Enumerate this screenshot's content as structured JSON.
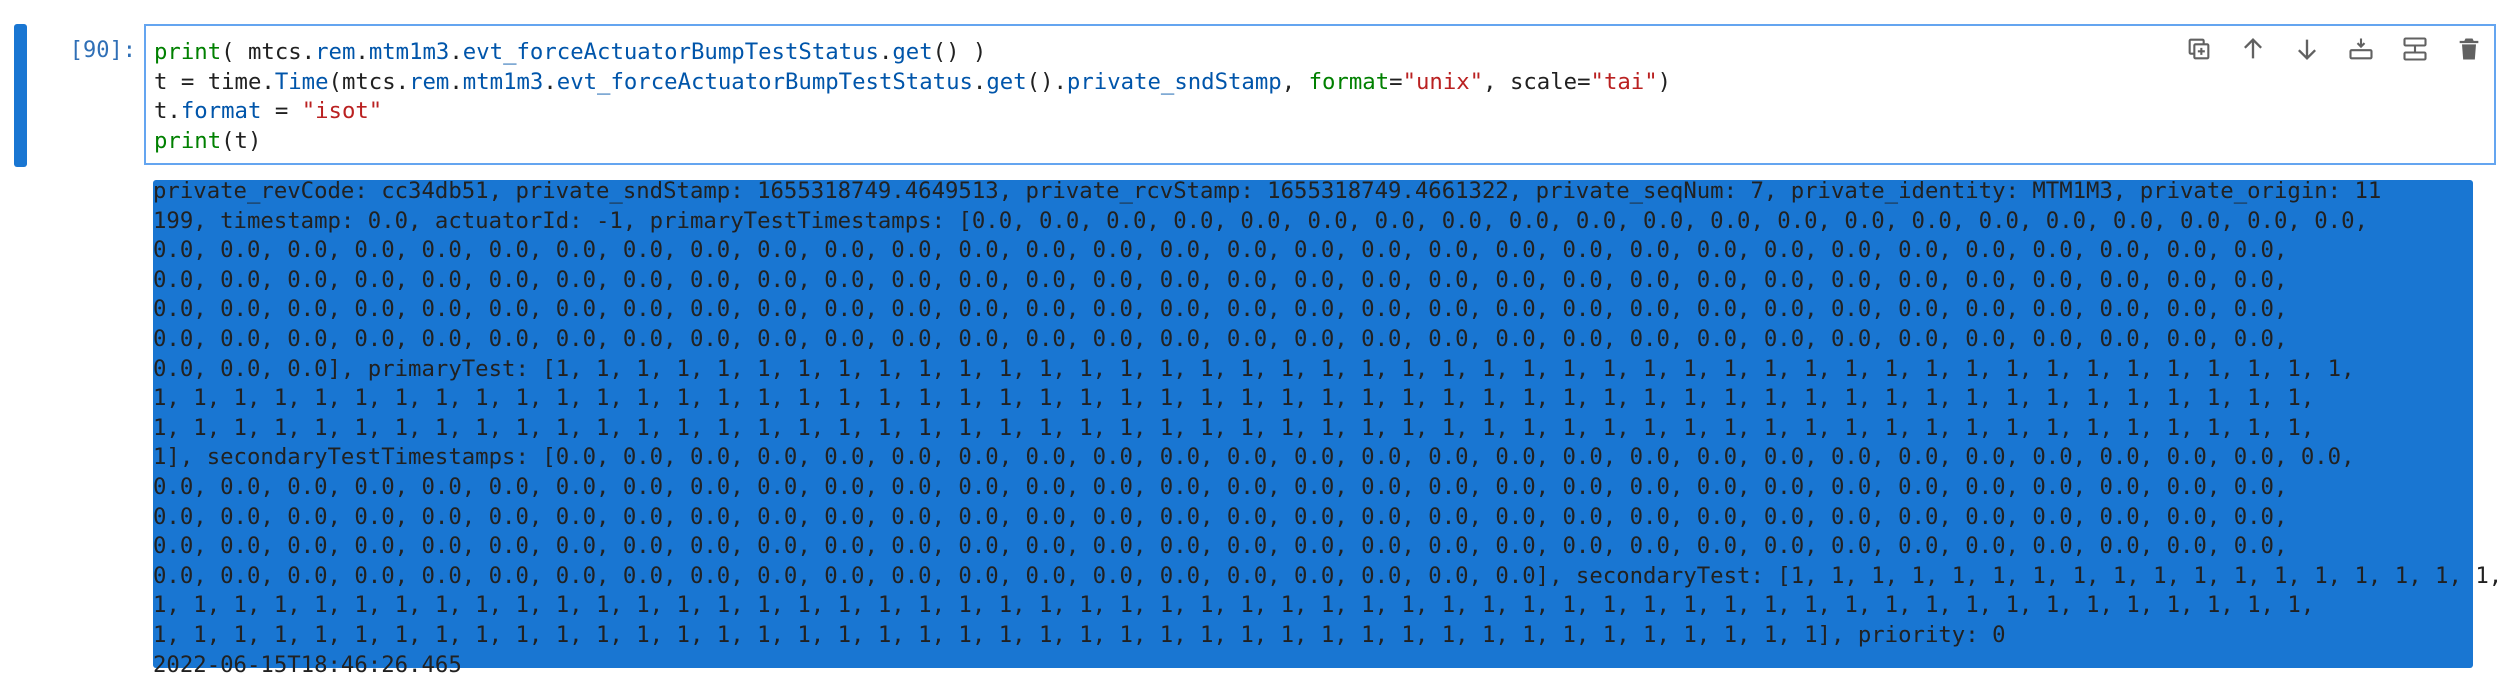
{
  "cell": {
    "prompt": "[90]:",
    "code_lines": [
      [
        {
          "t": "print",
          "c": "kw-builtin"
        },
        {
          "t": "( mtcs.",
          "c": ""
        },
        {
          "t": "rem",
          "c": "obj"
        },
        {
          "t": ".",
          "c": ""
        },
        {
          "t": "mtm1m3",
          "c": "obj"
        },
        {
          "t": ".",
          "c": ""
        },
        {
          "t": "evt_forceActuatorBumpTestStatus",
          "c": "obj"
        },
        {
          "t": ".",
          "c": ""
        },
        {
          "t": "get",
          "c": "obj"
        },
        {
          "t": "() )",
          "c": ""
        }
      ],
      [
        {
          "t": "t = time.",
          "c": ""
        },
        {
          "t": "Time",
          "c": "obj"
        },
        {
          "t": "(mtcs.",
          "c": ""
        },
        {
          "t": "rem",
          "c": "obj"
        },
        {
          "t": ".",
          "c": ""
        },
        {
          "t": "mtm1m3",
          "c": "obj"
        },
        {
          "t": ".",
          "c": ""
        },
        {
          "t": "evt_forceActuatorBumpTestStatus",
          "c": "obj"
        },
        {
          "t": ".",
          "c": ""
        },
        {
          "t": "get",
          "c": "obj"
        },
        {
          "t": "().",
          "c": ""
        },
        {
          "t": "private_sndStamp",
          "c": "obj"
        },
        {
          "t": ", ",
          "c": ""
        },
        {
          "t": "format",
          "c": "arg"
        },
        {
          "t": "=",
          "c": ""
        },
        {
          "t": "\"unix\"",
          "c": "str"
        },
        {
          "t": ", scale=",
          "c": ""
        },
        {
          "t": "\"tai\"",
          "c": "str"
        },
        {
          "t": ")",
          "c": ""
        }
      ],
      [
        {
          "t": "t.",
          "c": ""
        },
        {
          "t": "format",
          "c": "obj"
        },
        {
          "t": " = ",
          "c": ""
        },
        {
          "t": "\"isot\"",
          "c": "str"
        }
      ],
      [
        {
          "t": "print",
          "c": "kw-builtin"
        },
        {
          "t": "(t)",
          "c": ""
        }
      ]
    ],
    "output_lines": [
      "private_revCode: cc34db51, private_sndStamp: 1655318749.4649513, private_rcvStamp: 1655318749.4661322, private_seqNum: 7, private_identity: MTM1M3, private_origin: 11",
      "199, timestamp: 0.0, actuatorId: -1, primaryTestTimestamps: [0.0, 0.0, 0.0, 0.0, 0.0, 0.0, 0.0, 0.0, 0.0, 0.0, 0.0, 0.0, 0.0, 0.0, 0.0, 0.0, 0.0, 0.0, 0.0, 0.0, 0.0,",
      "0.0, 0.0, 0.0, 0.0, 0.0, 0.0, 0.0, 0.0, 0.0, 0.0, 0.0, 0.0, 0.0, 0.0, 0.0, 0.0, 0.0, 0.0, 0.0, 0.0, 0.0, 0.0, 0.0, 0.0, 0.0, 0.0, 0.0, 0.0, 0.0, 0.0, 0.0, 0.0,",
      "0.0, 0.0, 0.0, 0.0, 0.0, 0.0, 0.0, 0.0, 0.0, 0.0, 0.0, 0.0, 0.0, 0.0, 0.0, 0.0, 0.0, 0.0, 0.0, 0.0, 0.0, 0.0, 0.0, 0.0, 0.0, 0.0, 0.0, 0.0, 0.0, 0.0, 0.0, 0.0,",
      "0.0, 0.0, 0.0, 0.0, 0.0, 0.0, 0.0, 0.0, 0.0, 0.0, 0.0, 0.0, 0.0, 0.0, 0.0, 0.0, 0.0, 0.0, 0.0, 0.0, 0.0, 0.0, 0.0, 0.0, 0.0, 0.0, 0.0, 0.0, 0.0, 0.0, 0.0, 0.0,",
      "0.0, 0.0, 0.0, 0.0, 0.0, 0.0, 0.0, 0.0, 0.0, 0.0, 0.0, 0.0, 0.0, 0.0, 0.0, 0.0, 0.0, 0.0, 0.0, 0.0, 0.0, 0.0, 0.0, 0.0, 0.0, 0.0, 0.0, 0.0, 0.0, 0.0, 0.0, 0.0,",
      "0.0, 0.0, 0.0], primaryTest: [1, 1, 1, 1, 1, 1, 1, 1, 1, 1, 1, 1, 1, 1, 1, 1, 1, 1, 1, 1, 1, 1, 1, 1, 1, 1, 1, 1, 1, 1, 1, 1, 1, 1, 1, 1, 1, 1, 1, 1, 1, 1, 1, 1, 1,",
      "1, 1, 1, 1, 1, 1, 1, 1, 1, 1, 1, 1, 1, 1, 1, 1, 1, 1, 1, 1, 1, 1, 1, 1, 1, 1, 1, 1, 1, 1, 1, 1, 1, 1, 1, 1, 1, 1, 1, 1, 1, 1, 1, 1, 1, 1, 1, 1, 1, 1, 1, 1, 1, 1,",
      "1, 1, 1, 1, 1, 1, 1, 1, 1, 1, 1, 1, 1, 1, 1, 1, 1, 1, 1, 1, 1, 1, 1, 1, 1, 1, 1, 1, 1, 1, 1, 1, 1, 1, 1, 1, 1, 1, 1, 1, 1, 1, 1, 1, 1, 1, 1, 1, 1, 1, 1, 1, 1, 1,",
      "1], secondaryTestTimestamps: [0.0, 0.0, 0.0, 0.0, 0.0, 0.0, 0.0, 0.0, 0.0, 0.0, 0.0, 0.0, 0.0, 0.0, 0.0, 0.0, 0.0, 0.0, 0.0, 0.0, 0.0, 0.0, 0.0, 0.0, 0.0, 0.0, 0.0,",
      "0.0, 0.0, 0.0, 0.0, 0.0, 0.0, 0.0, 0.0, 0.0, 0.0, 0.0, 0.0, 0.0, 0.0, 0.0, 0.0, 0.0, 0.0, 0.0, 0.0, 0.0, 0.0, 0.0, 0.0, 0.0, 0.0, 0.0, 0.0, 0.0, 0.0, 0.0, 0.0,",
      "0.0, 0.0, 0.0, 0.0, 0.0, 0.0, 0.0, 0.0, 0.0, 0.0, 0.0, 0.0, 0.0, 0.0, 0.0, 0.0, 0.0, 0.0, 0.0, 0.0, 0.0, 0.0, 0.0, 0.0, 0.0, 0.0, 0.0, 0.0, 0.0, 0.0, 0.0, 0.0,",
      "0.0, 0.0, 0.0, 0.0, 0.0, 0.0, 0.0, 0.0, 0.0, 0.0, 0.0, 0.0, 0.0, 0.0, 0.0, 0.0, 0.0, 0.0, 0.0, 0.0, 0.0, 0.0, 0.0, 0.0, 0.0, 0.0, 0.0, 0.0, 0.0, 0.0, 0.0, 0.0,",
      "0.0, 0.0, 0.0, 0.0, 0.0, 0.0, 0.0, 0.0, 0.0, 0.0, 0.0, 0.0, 0.0, 0.0, 0.0, 0.0, 0.0, 0.0, 0.0, 0.0, 0.0], secondaryTest: [1, 1, 1, 1, 1, 1, 1, 1, 1, 1, 1, 1, 1, 1, 1, 1, 1, 1,",
      "1, 1, 1, 1, 1, 1, 1, 1, 1, 1, 1, 1, 1, 1, 1, 1, 1, 1, 1, 1, 1, 1, 1, 1, 1, 1, 1, 1, 1, 1, 1, 1, 1, 1, 1, 1, 1, 1, 1, 1, 1, 1, 1, 1, 1, 1, 1, 1, 1, 1, 1, 1, 1, 1,",
      "1, 1, 1, 1, 1, 1, 1, 1, 1, 1, 1, 1, 1, 1, 1, 1, 1, 1, 1, 1, 1, 1, 1, 1, 1, 1, 1, 1, 1, 1, 1, 1, 1, 1, 1, 1, 1, 1, 1, 1, 1, 1], priority: 0",
      "2022-06-15T18:46:26.465"
    ]
  },
  "toolbar": [
    {
      "name": "duplicate-cell-button",
      "icon": "duplicate-icon"
    },
    {
      "name": "move-cell-up-button",
      "icon": "arrow-up-icon"
    },
    {
      "name": "move-cell-down-button",
      "icon": "arrow-down-icon"
    },
    {
      "name": "insert-cell-below-button",
      "icon": "insert-below-icon"
    },
    {
      "name": "split-cell-button",
      "icon": "split-icon"
    },
    {
      "name": "delete-cell-button",
      "icon": "trash-icon"
    }
  ],
  "colors": {
    "collapser": "#1976d2",
    "prompt": "#2f6fb6",
    "editor_border": "#64a5f0",
    "builtin": "#008000",
    "attribute": "#0055aa",
    "string": "#ba2121",
    "icon": "#616161"
  }
}
